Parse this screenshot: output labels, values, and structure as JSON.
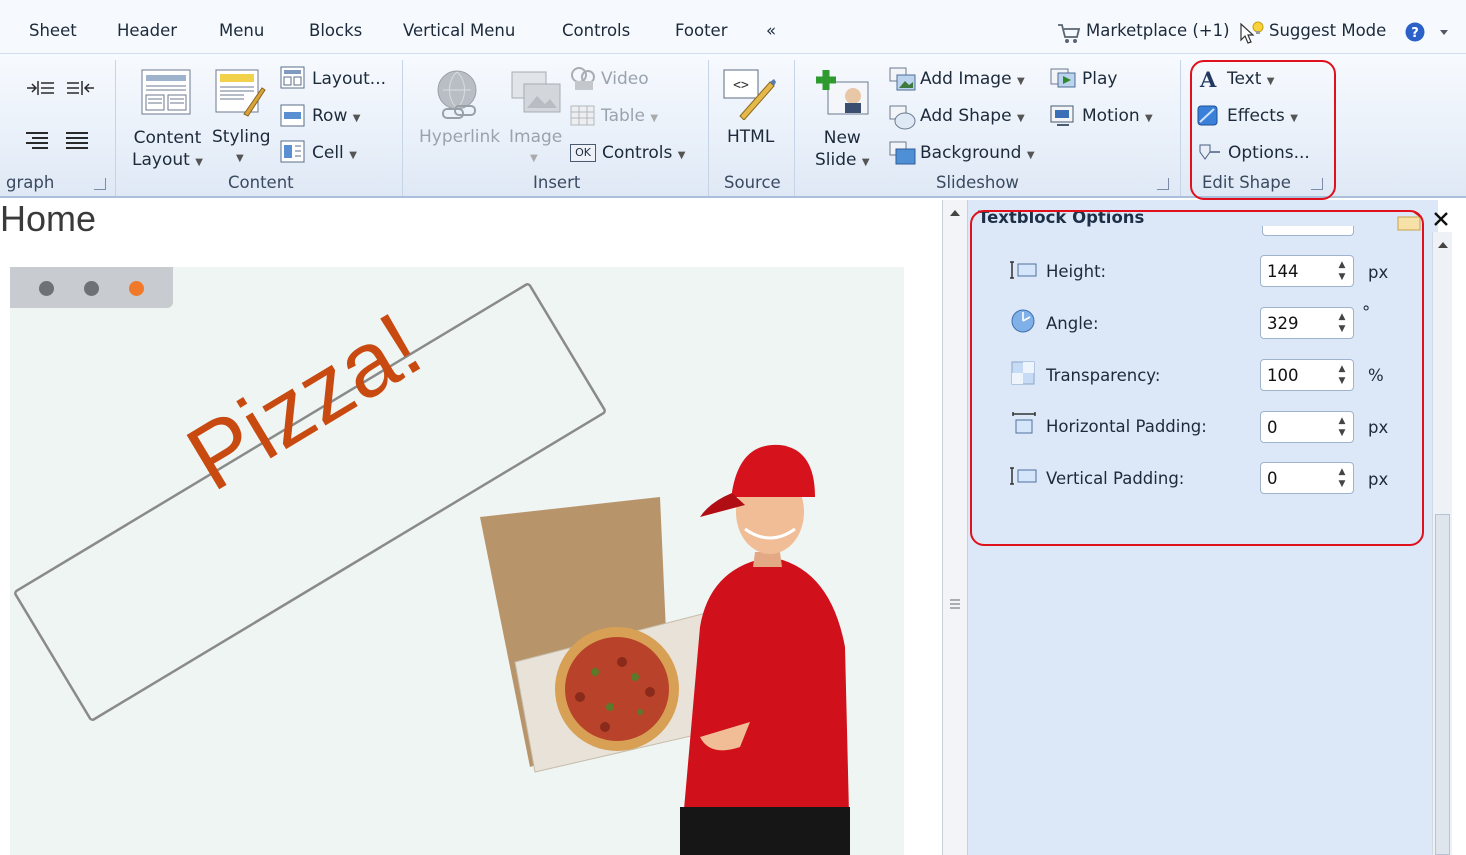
{
  "tabs": [
    "Sheet",
    "Header",
    "Menu",
    "Blocks",
    "Vertical Menu",
    "Controls",
    "Footer"
  ],
  "collapse_glyph": "«",
  "right_menu": {
    "marketplace": "Marketplace (+1)",
    "suggest_mode": "Suggest Mode"
  },
  "ribbon": {
    "paragraph_group": "graph",
    "content": {
      "content_layout_line1": "Content",
      "content_layout_line2": "Layout",
      "styling": "Styling",
      "layout": "Layout...",
      "row": "Row",
      "cell": "Cell",
      "group": "Content"
    },
    "insert": {
      "hyperlink": "Hyperlink",
      "image": "Image",
      "video": "Video",
      "table": "Table",
      "controls": "Controls",
      "controls_badge": "OK",
      "group": "Insert"
    },
    "source": {
      "html": "HTML",
      "group": "Source"
    },
    "slideshow": {
      "new_slide_line1": "New",
      "new_slide_line2": "Slide",
      "add_image": "Add Image",
      "add_shape": "Add Shape",
      "background": "Background",
      "play": "Play",
      "motion": "Motion",
      "group": "Slideshow"
    },
    "edit_shape": {
      "text": "Text",
      "effects": "Effects",
      "options": "Options...",
      "group": "Edit Shape"
    }
  },
  "canvas": {
    "page_title": "Home",
    "slide_text": "Pizza!"
  },
  "panel": {
    "title": "Textblock Options",
    "rows": [
      {
        "label": "Height:",
        "value": "144",
        "unit": "px"
      },
      {
        "label": "Angle:",
        "value": "329",
        "unit": "°"
      },
      {
        "label": "Transparency:",
        "value": "100",
        "unit": "%"
      },
      {
        "label": "Horizontal Padding:",
        "value": "0",
        "unit": "px"
      },
      {
        "label": "Vertical Padding:",
        "value": "0",
        "unit": "px"
      }
    ]
  },
  "colors": {
    "highlight": "#e0101c",
    "pizza_text": "#c94a10",
    "panel_bg": "#dce8f8",
    "dot_active": "#f07a2a",
    "dot_inactive": "#6e7276"
  }
}
